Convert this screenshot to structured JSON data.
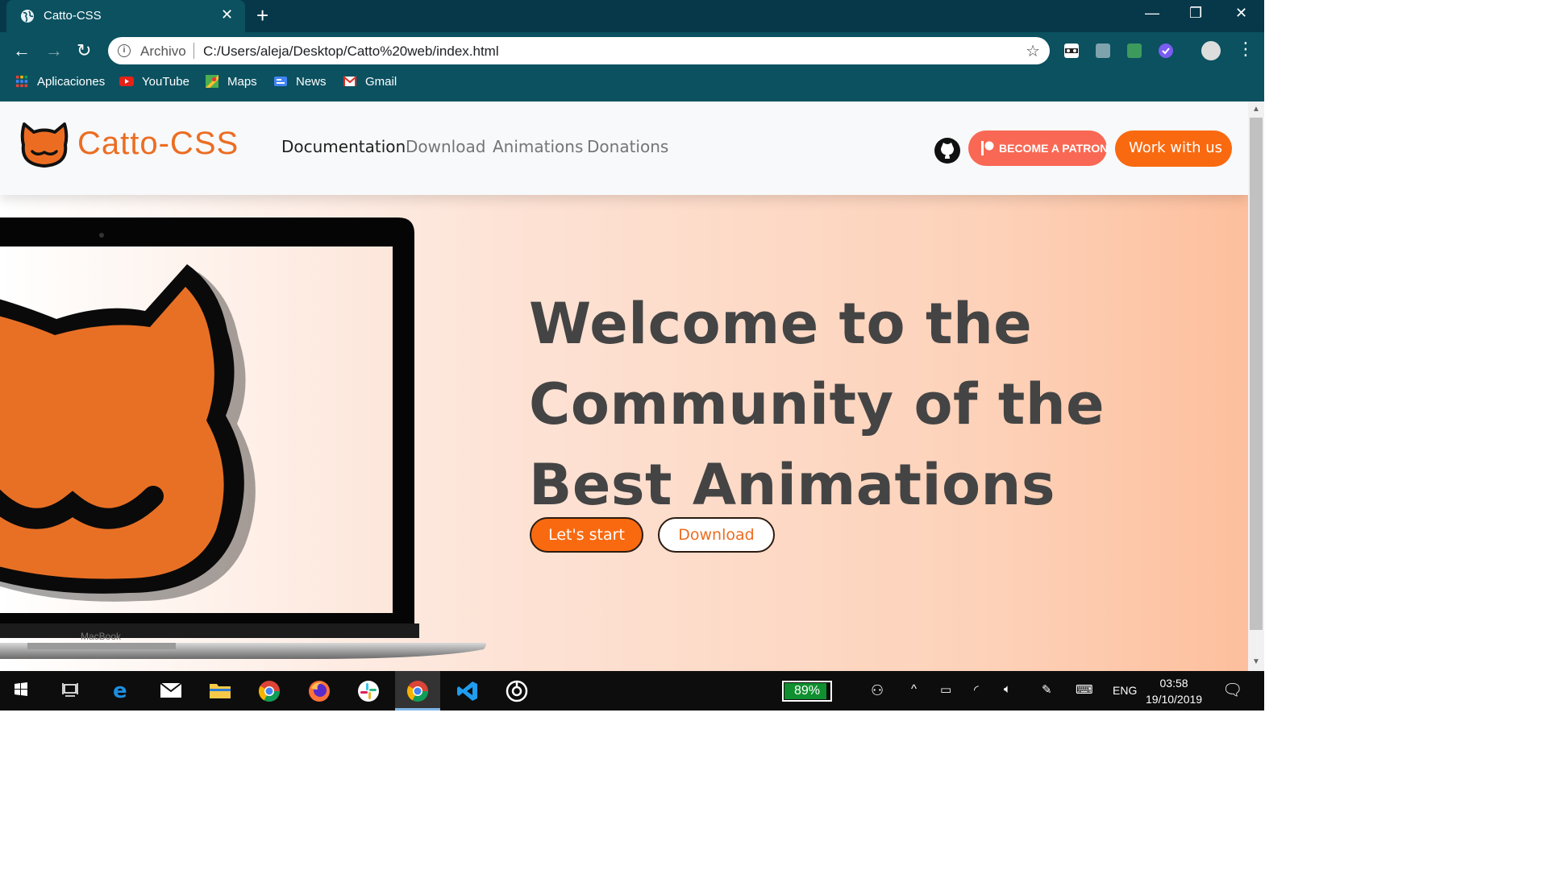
{
  "browser": {
    "tab_title": "Catto-CSS",
    "tab_close": "✕",
    "new_tab": "+",
    "window_controls": {
      "minimize": "—",
      "restore": "❐",
      "close": "✕"
    },
    "omnibox": {
      "scheme_label": "Archivo",
      "url": "C:/Users/aleja/Desktop/Catto%20web/index.html"
    },
    "bookmarks": [
      "Aplicaciones",
      "YouTube",
      "Maps",
      "News",
      "Gmail"
    ]
  },
  "site": {
    "brand": "Catto-CSS",
    "nav": [
      "Documentation",
      "Download",
      "Animations",
      "Donations"
    ],
    "patron_button": "BECOME A PATRON",
    "work_button": "Work with us",
    "laptop_label": "MacBook",
    "hero": {
      "line1": "Welcome to the",
      "line2": "Community of the",
      "line3": "Best Animations"
    },
    "start_button": "Let's start",
    "download_button": "Download"
  },
  "taskbar": {
    "battery": "89%",
    "language": "ENG",
    "time": "03:58",
    "date": "19/10/2019"
  },
  "colors": {
    "brand_orange": "#ec6d22",
    "button_orange": "#f96a10",
    "patreon_red": "#f96854",
    "chrome_teal": "#0b5160"
  }
}
